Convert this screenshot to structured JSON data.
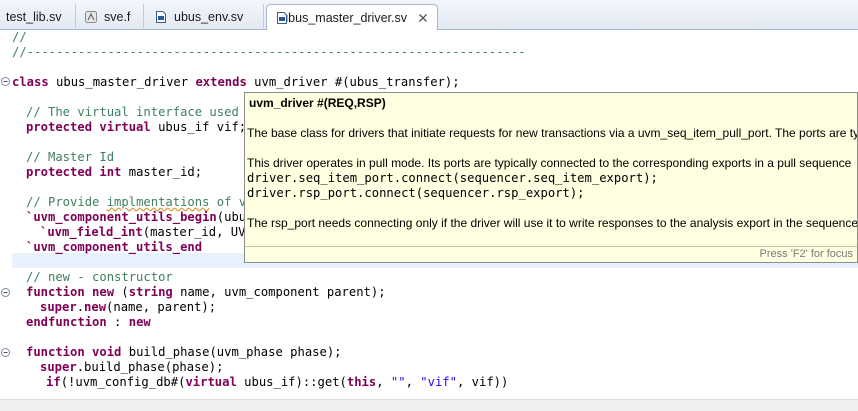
{
  "tabs": [
    {
      "label": "test_lib.sv",
      "icon": "sv-file-icon",
      "active": false
    },
    {
      "label": "sve.f",
      "icon": "f-file-icon",
      "active": false
    },
    {
      "label": "ubus_env.sv",
      "icon": "sv-file-icon",
      "active": false
    },
    {
      "label": "ubus_master_driver.sv",
      "icon": "sv-file-icon",
      "active": true
    }
  ],
  "code": {
    "l1": "//",
    "l2": "//--------------------------------------------------------------------",
    "l3_kw1": "class",
    "l3_a": " ubus_master_driver ",
    "l3_kw2": "extends",
    "l3_b": " uvm_driver #(ubus_transfer);",
    "l4": "// The virtual interface used t",
    "l5_kw": "protected virtual",
    "l5_rest": " ubus_if vif;",
    "l6": "// Master Id",
    "l7_kw": "protected int",
    "l7_rest": " master_id;",
    "l8_a": "// Provide ",
    "l8_sq": "implmentations",
    "l8_b": " of vi",
    "l9_m": "`uvm_component_utils_begin",
    "l9_rest": "(ubus",
    "l10_m": "`uvm_field_int",
    "l10_rest": "(master_id, UVM",
    "l11_m": "`uvm_component_utils_end",
    "l12": "// new - constructor",
    "l13_kw1": "function new",
    "l13_a": " (",
    "l13_kw2": "string",
    "l13_b": " name, uvm_component parent);",
    "l14_kw": "super",
    "l14_a": ".",
    "l14_kw2": "new",
    "l14_b": "(name, parent);",
    "l15_kw1": "endfunction",
    "l15_a": " : ",
    "l15_kw2": "new",
    "l16_kw": "function void",
    "l16_rest": " build_phase(uvm_phase phase);",
    "l17_kw": "super",
    "l17_rest": ".build_phase(phase);",
    "l18_kw1": "if",
    "l18_a": "(!uvm_config_db#(",
    "l18_kw2": "virtual",
    "l18_b": " ubus_if)::get(",
    "l18_kw3": "this",
    "l18_c": ", ",
    "l18_s1": "\"\"",
    "l18_d": ", ",
    "l18_s2": "\"vif\"",
    "l18_e": ", vif))"
  },
  "tooltip": {
    "title": "uvm_driver #(REQ,RSP)",
    "p1": "The base class for drivers that initiate requests for new transactions via a uvm_seq_item_pull_port. The ports are typ",
    "p2": "This driver operates in pull mode. Its ports are typically connected to the corresponding exports in a pull sequence",
    "code1": "driver.seq_item_port.connect(sequencer.seq_item_export);",
    "code2": "driver.rsp_port.connect(sequencer.rsp_export);",
    "p3": "The rsp_port needs connecting only if the driver will use it to write responses to the analysis export in the sequence",
    "hint": "Press 'F2' for focus"
  }
}
